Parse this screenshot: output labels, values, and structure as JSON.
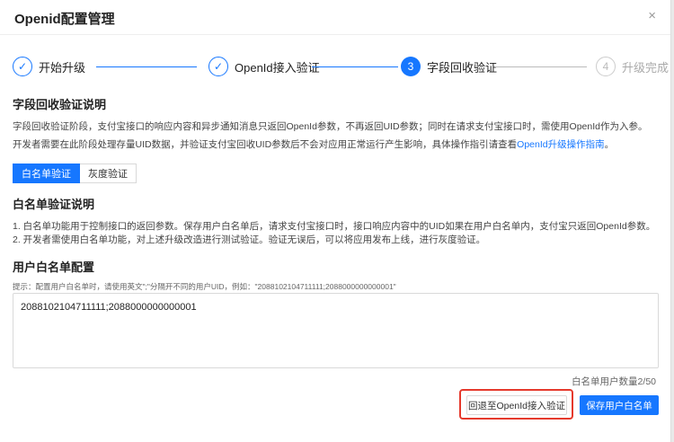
{
  "dialog": {
    "title": "Openid配置管理",
    "close": "×"
  },
  "steps": [
    {
      "num": "✓",
      "label": "开始升级"
    },
    {
      "num": "✓",
      "label": "OpenId接入验证"
    },
    {
      "num": "3",
      "label": "字段回收验证"
    },
    {
      "num": "4",
      "label": "升级完成"
    }
  ],
  "section1": {
    "heading": "字段回收验证说明",
    "line1": "字段回收验证阶段，支付宝接口的响应内容和异步通知消息只返回OpenId参数，不再返回UID参数；同时在请求支付宝接口时，需使用OpenId作为入参。",
    "line2_prefix": "开发者需要在此阶段处理存量UID数据，并验证支付宝回收UID参数后不会对应用正常运行产生影响，具体操作指引请查看",
    "line2_link": "OpenId升级操作指南",
    "line2_suffix": "。"
  },
  "tabs": {
    "whitelist": "白名单验证",
    "gray": "灰度验证"
  },
  "section2": {
    "heading": "白名单验证说明",
    "item1": "1. 白名单功能用于控制接口的返回参数。保存用户白名单后，请求支付宝接口时，接口响应内容中的UID如果在用户白名单内，支付宝只返回OpenId参数。",
    "item2": "2. 开发者需使用白名单功能，对上述升级改造进行测试验证。验证无误后，可以将应用发布上线，进行灰度验证。"
  },
  "section3": {
    "heading": "用户白名单配置",
    "hint": "提示：配置用户白名单时，请使用英文\";\"分隔开不同的用户UID，例如：\"2088102104711111;2088000000000001\"",
    "value": "2088102104711111;2088000000000001",
    "count": "白名单用户数量2/50"
  },
  "buttons": {
    "back": "回退至OpenId接入验证",
    "save": "保存用户白名单"
  },
  "colors": {
    "primary": "#1677ff",
    "highlight": "#e5392c"
  }
}
